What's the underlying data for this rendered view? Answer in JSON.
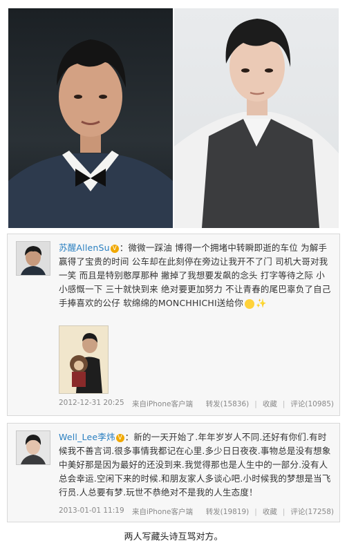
{
  "posts": [
    {
      "username": "苏醒AllenSu",
      "text": "微微一踩油 博得一个拥堵中转瞬即逝的车位 为解手赢得了宝贵的时间 公车却在此刻停在旁边让我开不了门 司机大哥对我一笑 而且是特别憨厚那种 撇掉了我想要发飙的念头 打字等待之际 小小感慨一下 三十就快到来 绝对要更加努力 不让青春的尾巴辜负了自己 手捧喜欢的公仔 软绵绵的MONCHHICHI送给你",
      "date": "2012-12-31 20:25",
      "source": "来自iPhone客户端",
      "repost": "转发(15836)",
      "favorite": "收藏",
      "comment": "评论(10985)"
    },
    {
      "username": "Well_Lee李炜",
      "text": "新的一天开始了.年年岁岁人不同.还好有你们.有时候我不善言词.很多事情我都记在心里.多少日日夜夜.事物总是没有想象中美好那是因为最好的还没到来.我觉得那也是人生中的一部分.没有人总会幸运.空闲下来的时候.和朋友家人多谈心吧.小时候我的梦想是当飞行员.人总要有梦.玩世不恭绝对不是我的人生态度！",
      "date": "2013-01-01 11:19",
      "source": "来自iPhone客户端",
      "repost": "转发(19819)",
      "favorite": "收藏",
      "comment": "评论(17258)"
    }
  ],
  "caption": "两人写藏头诗互骂对方。",
  "colors": {
    "username": "#2a7fc0",
    "meta": "#888888",
    "panel": "#f7f7f7",
    "border": "#d8d8d8"
  }
}
